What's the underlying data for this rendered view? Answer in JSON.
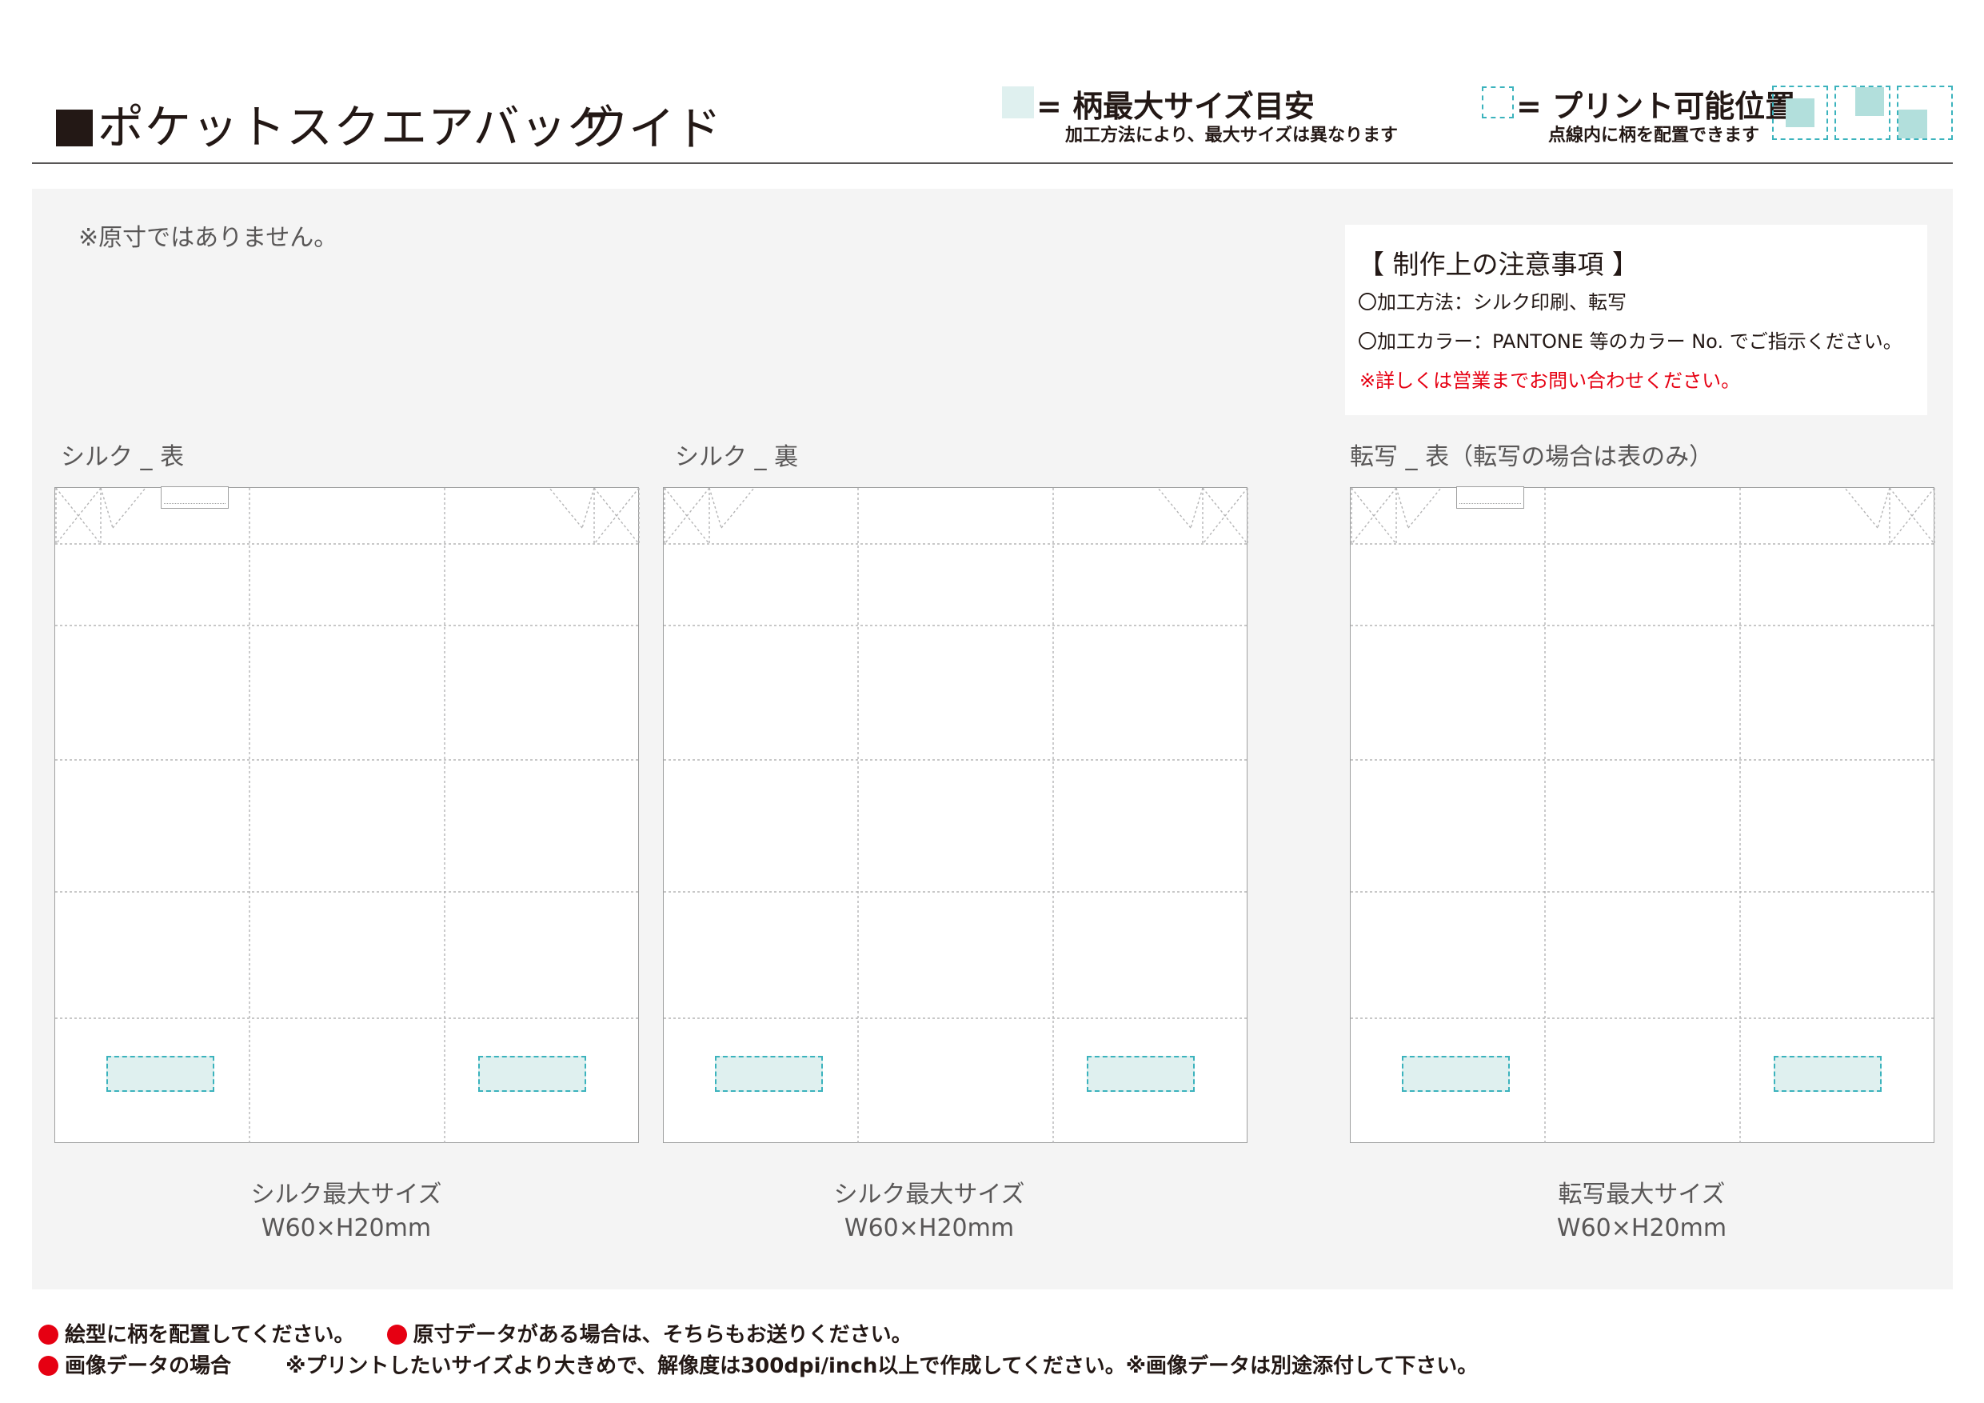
{
  "header": {
    "title": "ポケットスクエアバッグ",
    "title_variant": "ワイド",
    "legend_max_size": "= 柄最大サイズ目安",
    "legend_max_size_note": "加工方法により、最大サイズは異なります",
    "legend_print_pos": "= プリント可能位置",
    "legend_print_pos_note": "点線内に柄を配置できます"
  },
  "notice_scale": "※原寸ではありません。",
  "notes": {
    "title": "【 制作上の注意事項 】",
    "line1": "〇加工方法：シルク印刷、転写",
    "line2": "〇加工カラー：PANTONE 等のカラー No. でご指示ください。",
    "line3_red": "※詳しくは営業までお問い合わせください。"
  },
  "templates": [
    {
      "label": "シルク _ 表",
      "caption_line1": "シルク最大サイズ",
      "caption_line2": "W60×H20mm"
    },
    {
      "label": "シルク _ 裏",
      "caption_line1": "シルク最大サイズ",
      "caption_line2": "W60×H20mm"
    },
    {
      "label": "転写 _ 表（転写の場合は表のみ）",
      "caption_line1": "転写最大サイズ",
      "caption_line2": "W60×H20mm"
    }
  ],
  "footer": {
    "line1a": "絵型に柄を配置してください。",
    "line1b": "原寸データがある場合は、そちらもお送りください。",
    "line2a": "画像データの場合",
    "line2b": "※プリントしたいサイズより大きめで、解像度は300dpi/inch以上で作成してください。※画像データは別途添付して下さい。"
  },
  "colors": {
    "accent_teal": "#3bb3bd",
    "area_fill": "#dff0ef",
    "warning_red": "#e60012"
  }
}
